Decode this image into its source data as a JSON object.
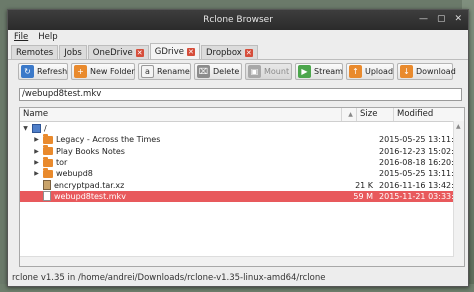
{
  "window": {
    "title": "Rclone Browser"
  },
  "menu": [
    "File",
    "Help"
  ],
  "tabs": [
    {
      "label": "Remotes",
      "active": false
    },
    {
      "label": "Jobs",
      "active": false
    },
    {
      "label": "OneDrive",
      "active": false
    },
    {
      "label": "GDrive",
      "active": true
    },
    {
      "label": "Dropbox",
      "active": false
    }
  ],
  "toolbar": {
    "refresh": "Refresh",
    "new_folder": "New Folder",
    "rename": "Rename",
    "delete": "Delete",
    "mount": "Mount",
    "stream": "Stream",
    "upload": "Upload",
    "download": "Download"
  },
  "path": "/webupd8test.mkv",
  "columns": {
    "name": "Name",
    "size": "Size",
    "modified": "Modified"
  },
  "tree": {
    "root": "/",
    "rows": [
      {
        "name": "Legacy - Across the Times",
        "size": "",
        "modified": "2015-05-25 13:11:56",
        "type": "folder",
        "selected": false
      },
      {
        "name": "Play Books Notes",
        "size": "",
        "modified": "2016-12-23 15:02:45",
        "type": "folder",
        "selected": false
      },
      {
        "name": "tor",
        "size": "",
        "modified": "2016-08-18 16:20:14",
        "type": "folder",
        "selected": false
      },
      {
        "name": "webupd8",
        "size": "",
        "modified": "2015-05-25 13:11:57",
        "type": "folder",
        "selected": false
      },
      {
        "name": "encryptpad.tar.xz",
        "size": "21 K",
        "modified": "2016-11-16 13:42:12",
        "type": "archive",
        "selected": false
      },
      {
        "name": "webupd8test.mkv",
        "size": "59 M",
        "modified": "2015-11-21 03:33:57",
        "type": "file",
        "selected": true
      }
    ]
  },
  "status": "rclone v1.35 in /home/andrei/Downloads/rclone-v1.35-linux-amd64/rclone",
  "colors": {
    "selection": "#e8595c",
    "folder": "#e98a2d"
  }
}
